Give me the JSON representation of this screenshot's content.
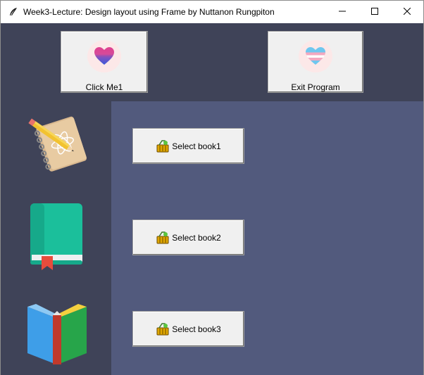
{
  "window": {
    "title": "Week3-Lecture: Design layout using Frame by Nuttanon Rungpiton",
    "app_icon": "feather-icon",
    "controls": [
      "minimize-icon",
      "maximize-icon",
      "close-icon"
    ]
  },
  "top_frame": {
    "bg_color": "#3f4358",
    "buttons": [
      {
        "label": "Click Me1",
        "icon": "bisexual-heart-icon"
      },
      {
        "label": "Exit Program",
        "icon": "trans-heart-icon"
      }
    ]
  },
  "left_frame": {
    "bg_color": "#3f4358",
    "images": [
      "notebook-pencil-icon",
      "green-book-icon",
      "open-book-icon"
    ]
  },
  "right_frame": {
    "bg_color": "#525a7d",
    "buttons": [
      {
        "label": "Select book1",
        "icon": "basket-icon"
      },
      {
        "label": "Select book2",
        "icon": "basket-icon"
      },
      {
        "label": "Select book3",
        "icon": "basket-icon"
      }
    ]
  }
}
